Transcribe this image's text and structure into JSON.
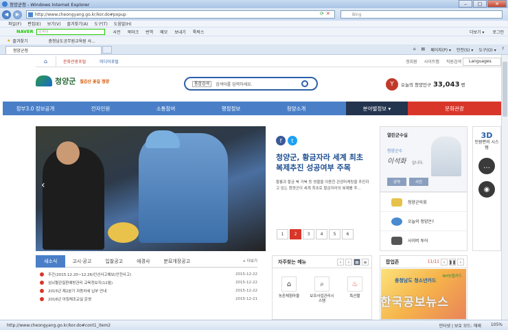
{
  "window": {
    "title": "청양군청 - Windows Internet Explorer"
  },
  "address": {
    "url": "http://www.cheongyang.go.kr/kor.do#popup",
    "search_placeholder": "Bing"
  },
  "menu": [
    "파일(F)",
    "편집(E)",
    "보기(V)",
    "즐겨찾기(A)",
    "도구(T)",
    "도움말(H)"
  ],
  "naver": {
    "logo": "NAVER",
    "placeholder": "검색어",
    "items": [
      "사전",
      "북마크",
      "번역",
      "메모",
      "보내기",
      "툭팍스"
    ],
    "right": [
      "더보기 ▾",
      "로그인"
    ]
  },
  "favorites": {
    "label": "즐겨찾기",
    "item": "충청남도공무원교육원 사..."
  },
  "tab": {
    "title": "청양군청"
  },
  "ie_tools": [
    "페이지(P) ▾",
    "안전(S) ▾",
    "도구(O) ▾"
  ],
  "site": {
    "toplinks": [
      "문화관광포털",
      "미디어포털"
    ],
    "util": [
      "정회원",
      "사이트맵",
      "직원검색"
    ],
    "language": "Languages",
    "logo_name": "청양군",
    "slogan": "칠갑산 꽃길 청양",
    "search": {
      "select": "통합검색",
      "placeholder": "검색어를 입력하세요."
    },
    "population": {
      "label": "오늘의 청양인구",
      "value": "33,043",
      "unit": "명"
    },
    "gnb": [
      "정부3.0 정보공개",
      "전자민원",
      "소통참여",
      "행정정보",
      "청양소개",
      "분야별정보 ▾",
      "문화관광"
    ],
    "headline": {
      "title": "청양군, 황금자라 세계 최초 복제추진 성공여부 주목",
      "body": "황룡과 황금 북 거북 등 영물을 이용한 관광마케팅을 추진하고 있는 청양군이 세계 최초로 황금자라의 복제를 추..."
    },
    "pager": [
      "1",
      "2",
      "3",
      "4",
      "5",
      "6"
    ],
    "mayor": {
      "title": "열린군수실",
      "sub": "청양군수",
      "sign": "이석화",
      "greet": "입니다.",
      "btn1": "공약",
      "btn2": "사진"
    },
    "quick": [
      "청양군의회",
      "오늘의 청양은?",
      "사이버 투어"
    ],
    "side": {
      "title": "3D",
      "sub": "민원편의 시스템"
    },
    "notice": {
      "tabs": [
        "새소식",
        "고시·공고",
        "입찰공고",
        "애경사",
        "분묘개장공고"
      ],
      "more": "+ 더보기",
      "items": [
        {
          "title": "주간(2015.12.20~12.26)인선사고예보(안전사고)",
          "date": "2015-12-22"
        },
        {
          "title": "심뇌혈관질환예방관리 교육정보지(12월)",
          "date": "2015-12-22"
        },
        {
          "title": "2015년 제2분기 자동차세 납부 안내",
          "date": "2015-12-22"
        },
        {
          "title": "2016년 아침체조교실 운영",
          "date": "2015-12-21"
        }
      ]
    },
    "freq": {
      "title": "자주찾는 메뉴",
      "items": [
        "농촌체험마을",
        "보조사업관리시스템",
        "특산물"
      ]
    },
    "popup": {
      "title": "팝업존",
      "count": "11/11",
      "card": "충청남도 청소년카드",
      "bank": "NH농협카드"
    }
  },
  "watermark": "한국공보뉴스",
  "status": {
    "url": "http://www.cheongyang.go.kr/kor.do#cont1_item2",
    "zone": "인터넷 | 보호 모드: 해제",
    "zoom": "105%"
  }
}
